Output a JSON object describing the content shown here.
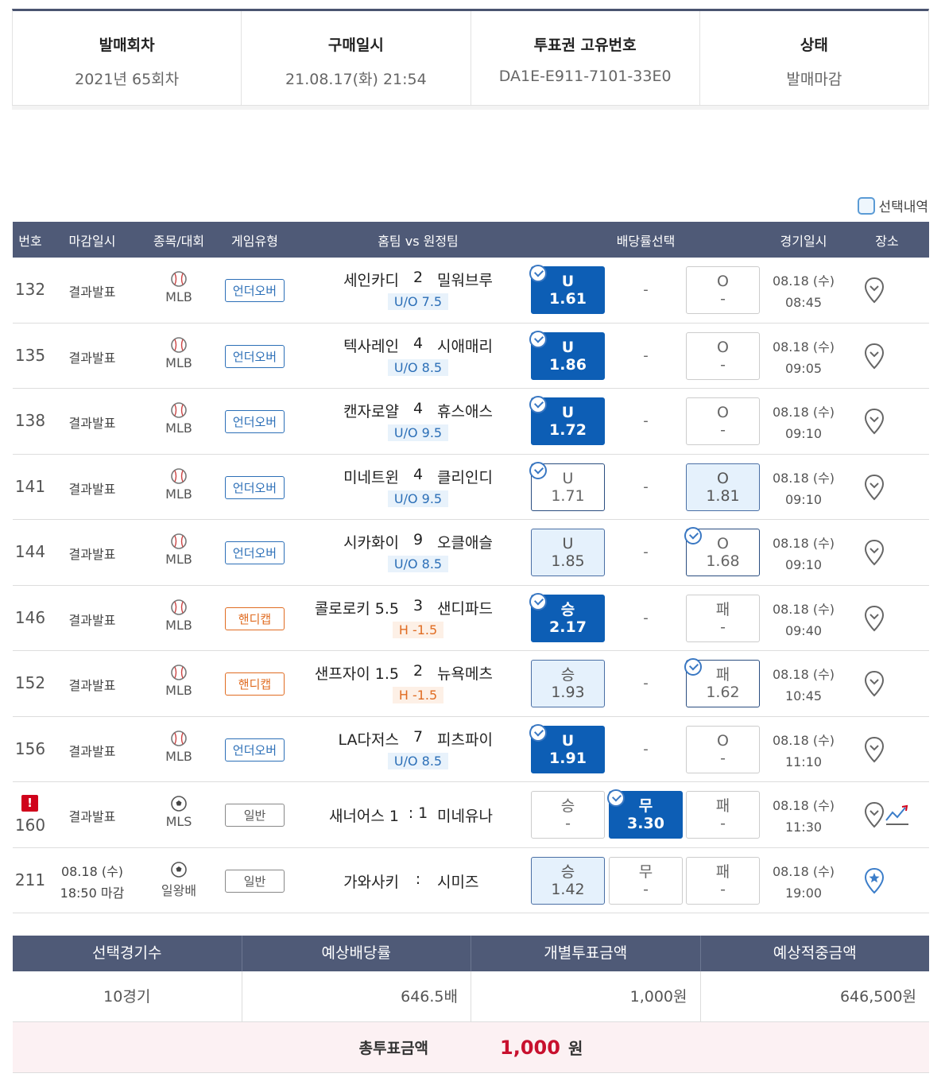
{
  "summary": {
    "round_label": "발매회차",
    "round_value": "2021년 65회차",
    "purchase_label": "구매일시",
    "purchase_value": "21.08.17(화) 21:54",
    "ticket_label": "투표권 고유번호",
    "ticket_value": "DA1E-E911-7101-33E0",
    "status_label": "상태",
    "status_value": "발매마감"
  },
  "selection_toggle": "선택내역",
  "table_head": {
    "num": "번호",
    "closing": "마감일시",
    "sport": "종목/대회",
    "type": "게임유형",
    "match": "홈팀 vs 원정팀",
    "odds": "배당률선택",
    "date": "경기일시",
    "venue": "장소"
  },
  "rows": [
    {
      "num": "132",
      "closing": "결과발표",
      "league": "MLB",
      "type": "언더오버",
      "home": "세인카디",
      "score": "2",
      "away": "밀워브루",
      "line": "U/O 7.5",
      "o1_t": "U",
      "o1_v": "1.61",
      "o3_t": "O",
      "o3_v": "-",
      "date": "08.18 (수)",
      "time": "08:45"
    },
    {
      "num": "135",
      "closing": "결과발표",
      "league": "MLB",
      "type": "언더오버",
      "home": "텍사레인",
      "score": "4",
      "away": "시애매리",
      "line": "U/O 8.5",
      "o1_t": "U",
      "o1_v": "1.86",
      "o3_t": "O",
      "o3_v": "-",
      "date": "08.18 (수)",
      "time": "09:05"
    },
    {
      "num": "138",
      "closing": "결과발표",
      "league": "MLB",
      "type": "언더오버",
      "home": "캔자로얄",
      "score": "4",
      "away": "휴스애스",
      "line": "U/O 9.5",
      "o1_t": "U",
      "o1_v": "1.72",
      "o3_t": "O",
      "o3_v": "-",
      "date": "08.18 (수)",
      "time": "09:10"
    },
    {
      "num": "141",
      "closing": "결과발표",
      "league": "MLB",
      "type": "언더오버",
      "home": "미네트윈",
      "score": "4",
      "away": "클리인디",
      "line": "U/O 9.5",
      "o1_t": "U",
      "o1_v": "1.71",
      "o3_t": "O",
      "o3_v": "1.81",
      "date": "08.18 (수)",
      "time": "09:10"
    },
    {
      "num": "144",
      "closing": "결과발표",
      "league": "MLB",
      "type": "언더오버",
      "home": "시카화이",
      "score": "9",
      "away": "오클애슬",
      "line": "U/O 8.5",
      "o1_t": "U",
      "o1_v": "1.85",
      "o3_t": "O",
      "o3_v": "1.68",
      "date": "08.18 (수)",
      "time": "09:10"
    },
    {
      "num": "146",
      "closing": "결과발표",
      "league": "MLB",
      "type": "핸디캡",
      "home": "콜로로키 5.5",
      "score": "3",
      "away": "샌디파드",
      "line": "H -1.5",
      "o1_t": "승",
      "o1_v": "2.17",
      "o3_t": "패",
      "o3_v": "-",
      "date": "08.18 (수)",
      "time": "09:40"
    },
    {
      "num": "152",
      "closing": "결과발표",
      "league": "MLB",
      "type": "핸디캡",
      "home": "샌프자이 1.5",
      "score": "2",
      "away": "뉴욕메츠",
      "line": "H -1.5",
      "o1_t": "승",
      "o1_v": "1.93",
      "o3_t": "패",
      "o3_v": "1.62",
      "date": "08.18 (수)",
      "time": "10:45"
    },
    {
      "num": "156",
      "closing": "결과발표",
      "league": "MLB",
      "type": "언더오버",
      "home": "LA다저스",
      "score": "7",
      "away": "피츠파이",
      "line": "U/O 8.5",
      "o1_t": "U",
      "o1_v": "1.91",
      "o3_t": "O",
      "o3_v": "-",
      "date": "08.18 (수)",
      "time": "11:10"
    },
    {
      "num": "160",
      "closing": "결과발표",
      "league": "MLS",
      "type": "일반",
      "home": "새너어스 1",
      "score": "1",
      "away": "미네유나",
      "line": "",
      "o1_t": "승",
      "o1_v": "-",
      "o2_t": "무",
      "o2_v": "3.30",
      "o3_t": "패",
      "o3_v": "-",
      "date": "08.18 (수)",
      "time": "11:30",
      "alert": "!"
    },
    {
      "num": "211",
      "closing": "08.18 (수)",
      "closing2": "18:50 마감",
      "league": "일왕배",
      "type": "일반",
      "home": "가와사키",
      "score": "",
      "away": "시미즈",
      "line": "",
      "o1_t": "승",
      "o1_v": "1.42",
      "o2_t": "무",
      "o2_v": "-",
      "o3_t": "패",
      "o3_v": "-",
      "date": "08.18 (수)",
      "time": "19:00"
    }
  ],
  "dash": "-",
  "colon": ":",
  "totals": {
    "h_games": "선택경기수",
    "h_odds": "예상배당률",
    "h_bet": "개별투표금액",
    "h_win": "예상적중금액",
    "games": "10경기",
    "odds": "646.5배",
    "bet": "1,000원",
    "win": "646,500원",
    "grand_label": "총투표금액",
    "grand_value": "1,000",
    "grand_unit": "원"
  },
  "colors": {
    "header_bg": "#4f5a77",
    "selected": "#0d5eb5",
    "accent_red": "#c8102e"
  }
}
